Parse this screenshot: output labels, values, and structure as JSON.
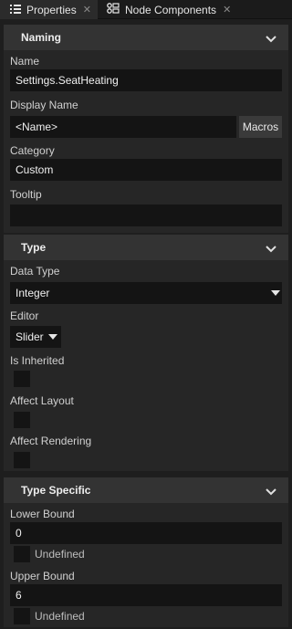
{
  "tabs": [
    {
      "label": "Properties",
      "icon": "list-icon",
      "active": true
    },
    {
      "label": "Node Components",
      "icon": "node-components-icon",
      "active": false
    }
  ],
  "sections": {
    "naming": {
      "title": "Naming",
      "name_label": "Name",
      "name_value": "Settings.SeatHeating",
      "display_name_label": "Display Name",
      "display_name_value": "<Name>",
      "macros_label": "Macros",
      "category_label": "Category",
      "category_value": "Custom",
      "tooltip_label": "Tooltip",
      "tooltip_value": ""
    },
    "type": {
      "title": "Type",
      "data_type_label": "Data Type",
      "data_type_value": "Integer",
      "editor_label": "Editor",
      "editor_value": "Slider",
      "is_inherited_label": "Is Inherited",
      "is_inherited_checked": false,
      "affect_layout_label": "Affect Layout",
      "affect_layout_checked": false,
      "affect_rendering_label": "Affect Rendering",
      "affect_rendering_checked": false
    },
    "type_specific": {
      "title": "Type Specific",
      "lower_bound_label": "Lower Bound",
      "lower_bound_value": "0",
      "lower_undefined_label": "Undefined",
      "lower_undefined_checked": false,
      "upper_bound_label": "Upper Bound",
      "upper_bound_value": "6",
      "upper_undefined_label": "Undefined",
      "upper_undefined_checked": false
    }
  },
  "colors": {
    "background": "#1e1e1e",
    "panel": "#262626",
    "section_header": "#333333",
    "field": "#141414",
    "text": "#d8d8d8"
  }
}
